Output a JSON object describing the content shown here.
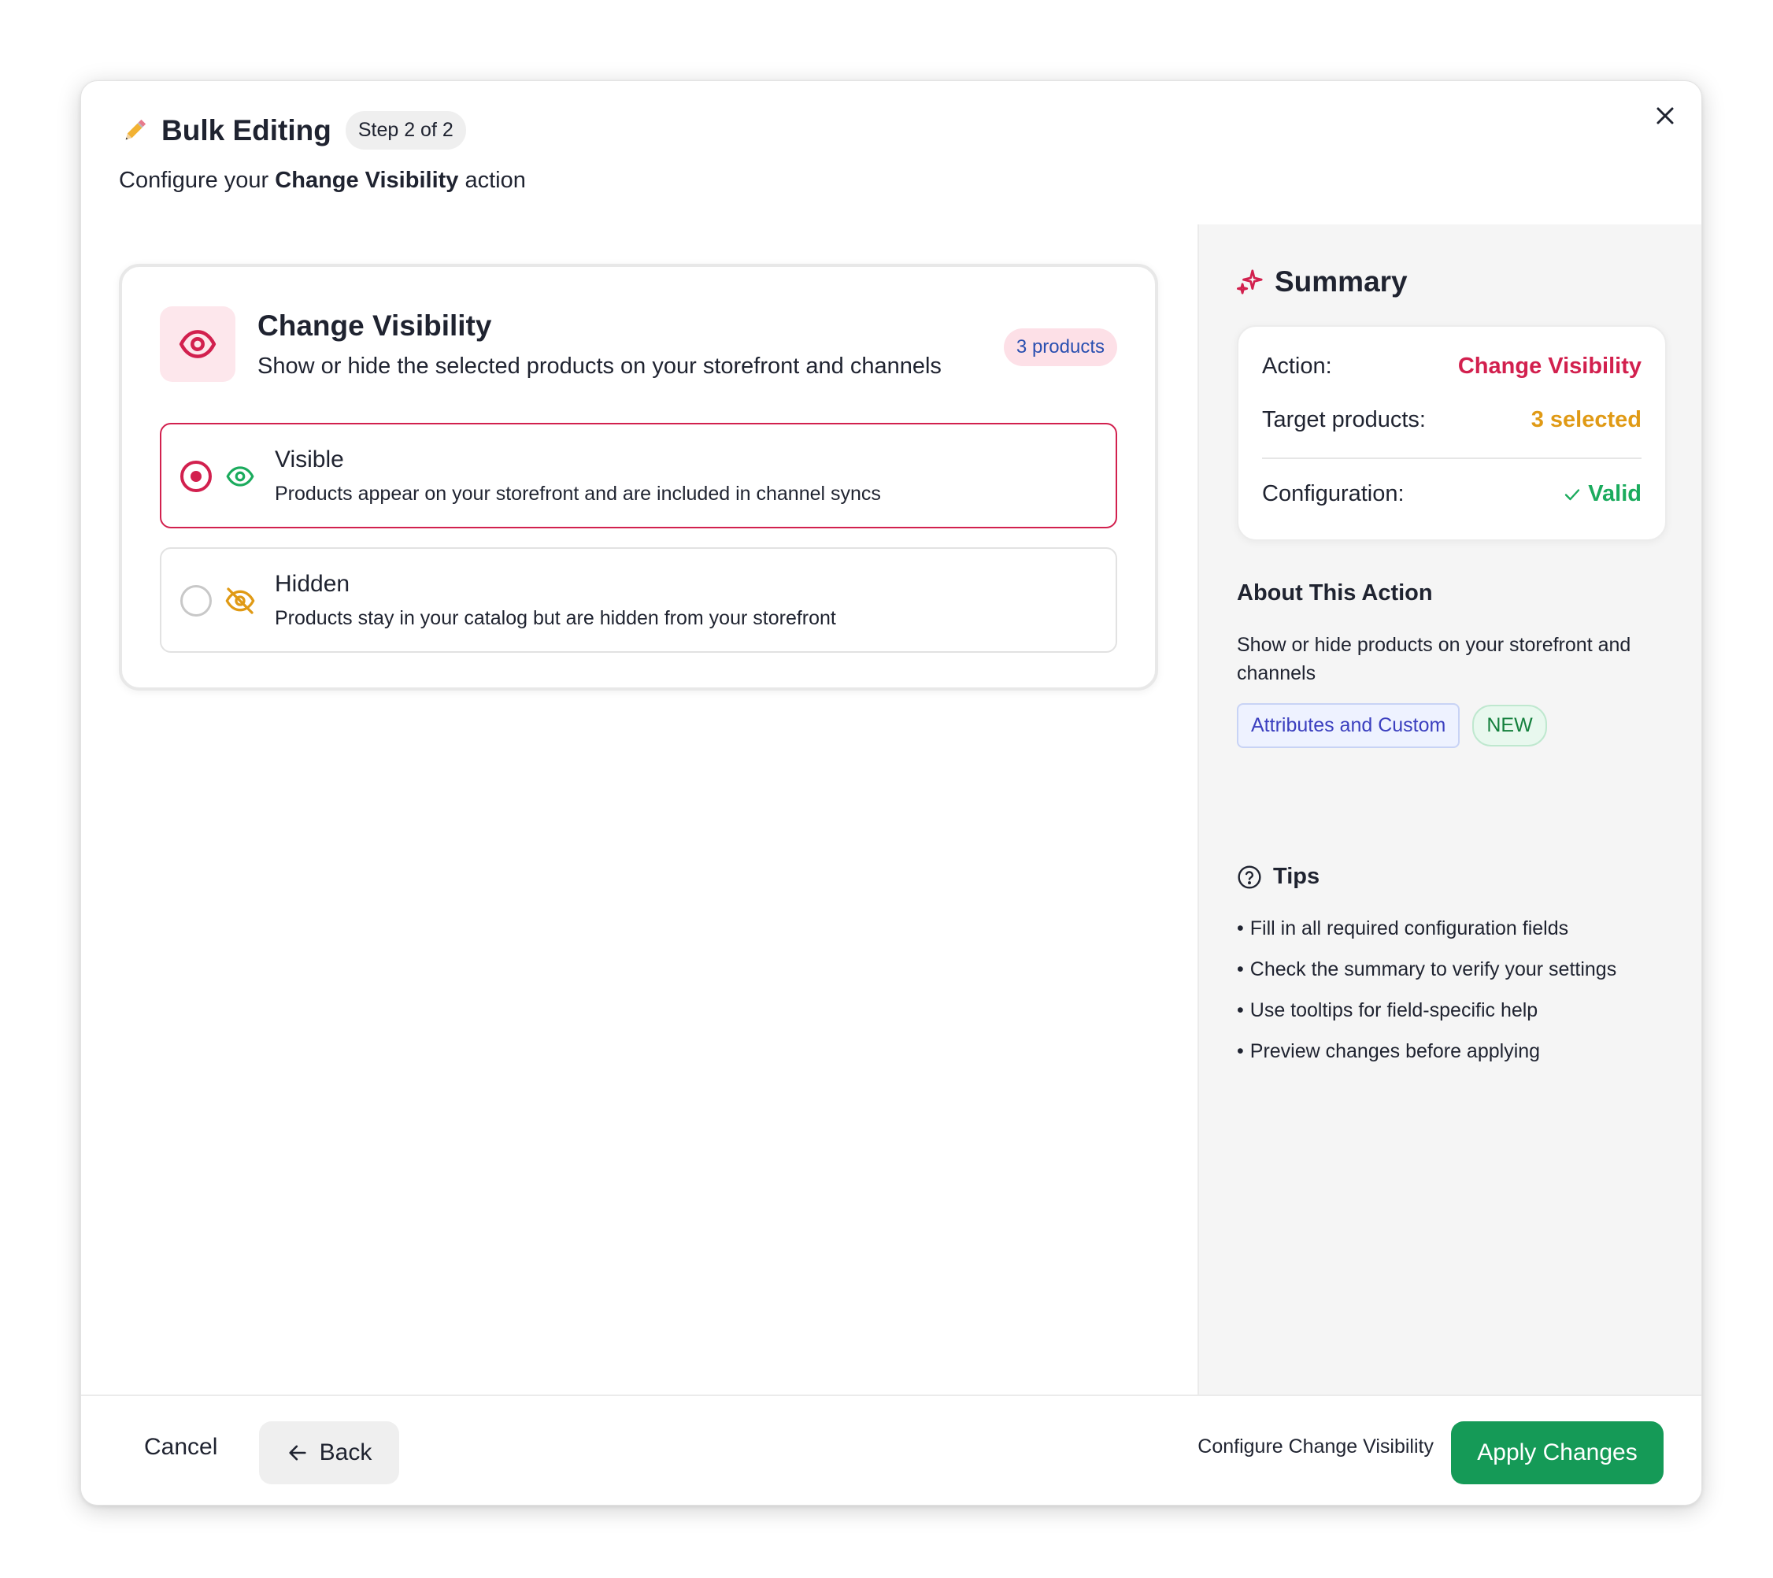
{
  "modal": {
    "title": "Bulk Editing",
    "step_badge": "Step 2 of 2",
    "subtitle_prefix": "Configure your ",
    "subtitle_bold": "Change Visibility",
    "subtitle_suffix": " action",
    "title_icon": "pencil-icon",
    "close_icon": "close-icon"
  },
  "config_card": {
    "icon": "eye-icon",
    "title": "Change Visibility",
    "description": "Show or hide the selected products on your storefront and channels",
    "products_badge": "3 products",
    "options": [
      {
        "label": "Visible",
        "description": "Products appear on your storefront and are included in channel syncs",
        "icon": "eye-icon",
        "selected": true
      },
      {
        "label": "Hidden",
        "description": "Products stay in your catalog but are hidden from your storefront",
        "icon": "eye-off-icon",
        "selected": false
      }
    ]
  },
  "summary": {
    "title": "Summary",
    "icon": "sparkles-icon",
    "rows": {
      "action_label": "Action:",
      "action_value": "Change Visibility",
      "target_label": "Target products:",
      "target_value": "3 selected",
      "config_label": "Configuration:",
      "config_value": "Valid"
    }
  },
  "about": {
    "title": "About This Action",
    "description": "Show or hide products on your storefront and channels",
    "tag_category": "Attributes and Custom",
    "tag_new": "NEW"
  },
  "tips": {
    "title": "Tips",
    "icon": "help-circle-icon",
    "items": [
      "Fill in all required configuration fields",
      "Check the summary to verify your settings",
      "Use tooltips for field-specific help",
      "Preview changes before applying"
    ]
  },
  "footer": {
    "cancel_label": "Cancel",
    "back_label": "Back",
    "note": "Configure Change Visibility",
    "apply_label": "Apply Changes"
  },
  "colors": {
    "accent": "#d2204e",
    "success": "#159a57",
    "warning": "#e09a15",
    "badge_text": "#2a4fb0"
  }
}
